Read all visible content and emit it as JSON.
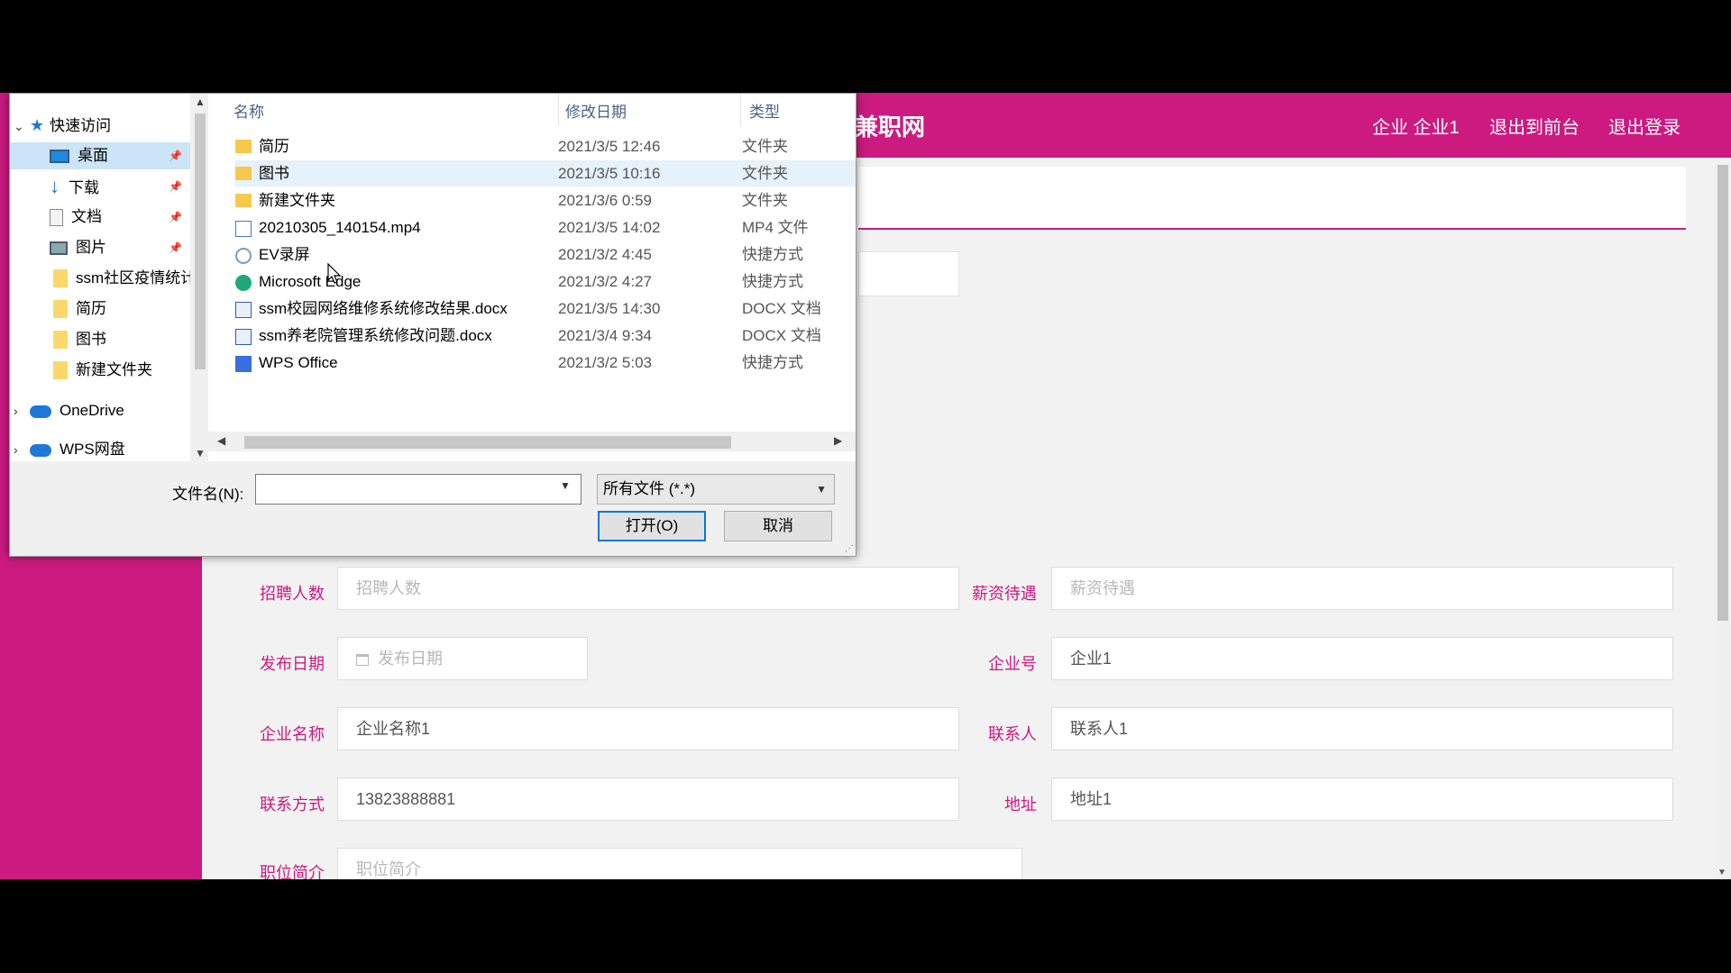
{
  "site": {
    "title": "兼职网",
    "top_links": [
      "企业 企业1",
      "退出到前台",
      "退出登录"
    ]
  },
  "form": {
    "rows": [
      {
        "left": {
          "label": "招聘人数",
          "value": "",
          "placeholder": "招聘人数"
        },
        "right": {
          "label": "薪资待遇",
          "value": "",
          "placeholder": "薪资待遇"
        }
      },
      {
        "left": {
          "label": "发布日期",
          "value": "",
          "placeholder": "发布日期"
        },
        "right": {
          "label": "企业号",
          "value": "企业1",
          "placeholder": ""
        }
      },
      {
        "left": {
          "label": "企业名称",
          "value": "企业名称1",
          "placeholder": ""
        },
        "right": {
          "label": "联系人",
          "value": "联系人1",
          "placeholder": ""
        }
      },
      {
        "left": {
          "label": "联系方式",
          "value": "13823888881",
          "placeholder": ""
        },
        "right": {
          "label": "地址",
          "value": "地址1",
          "placeholder": ""
        }
      },
      {
        "left": {
          "label": "职位简介",
          "value": "",
          "placeholder": "职位简介"
        }
      }
    ]
  },
  "dialog": {
    "nav": [
      {
        "label": "快速访问",
        "icon": "star-icon",
        "type": "header"
      },
      {
        "label": "桌面",
        "icon": "desktop-icon",
        "pinned": true,
        "selected": true
      },
      {
        "label": "下载",
        "icon": "download-icon",
        "pinned": true
      },
      {
        "label": "文档",
        "icon": "document-icon",
        "pinned": true
      },
      {
        "label": "图片",
        "icon": "pictures-icon",
        "pinned": true
      },
      {
        "label": "ssm社区疫情统计",
        "icon": "folder-icon"
      },
      {
        "label": "简历",
        "icon": "folder-icon"
      },
      {
        "label": "图书",
        "icon": "folder-icon"
      },
      {
        "label": "新建文件夹",
        "icon": "folder-icon"
      },
      {
        "label": "OneDrive",
        "icon": "cloud-icon",
        "type": "header"
      },
      {
        "label": "WPS网盘",
        "icon": "cloud-icon",
        "type": "header"
      }
    ],
    "columns": [
      "名称",
      "修改日期",
      "类型"
    ],
    "files": [
      {
        "name": "简历",
        "date": "2021/3/5 12:46",
        "type": "文件夹",
        "icon": "folder-icon"
      },
      {
        "name": "图书",
        "date": "2021/3/5 10:16",
        "type": "文件夹",
        "icon": "folder-icon",
        "hover": true
      },
      {
        "name": "新建文件夹",
        "date": "2021/3/6 0:59",
        "type": "文件夹",
        "icon": "folder-icon"
      },
      {
        "name": "20210305_140154.mp4",
        "date": "2021/3/5 14:02",
        "type": "MP4 文件",
        "icon": "video-file-icon"
      },
      {
        "name": "EV录屏",
        "date": "2021/3/2 4:45",
        "type": "快捷方式",
        "icon": "ev-recorder-icon"
      },
      {
        "name": "Microsoft Edge",
        "date": "2021/3/2 4:27",
        "type": "快捷方式",
        "icon": "edge-icon"
      },
      {
        "name": "ssm校园网络维修系统修改结果.docx",
        "date": "2021/3/5 14:30",
        "type": "DOCX 文档",
        "icon": "word-doc-icon"
      },
      {
        "name": "ssm养老院管理系统修改问题.docx",
        "date": "2021/3/4 9:34",
        "type": "DOCX 文档",
        "icon": "word-doc-icon"
      },
      {
        "name": "WPS Office",
        "date": "2021/3/2 5:03",
        "type": "快捷方式",
        "icon": "wps-icon"
      }
    ],
    "filename_label": "文件名(N):",
    "filename_value": "",
    "filetype": "所有文件 (*.*)",
    "open_label": "打开(O)",
    "cancel_label": "取消"
  },
  "colors": {
    "brand": "#cc1a80",
    "selection": "#cce4f7",
    "hover": "#e5f1fb"
  }
}
